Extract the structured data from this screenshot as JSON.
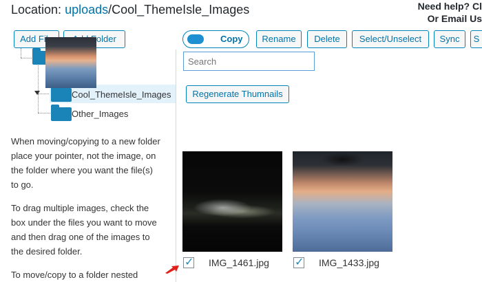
{
  "header": {
    "location_prefix": "Location: ",
    "location_link": "uploads",
    "location_rest": "/Cool_ThemeIsle_Images",
    "help_line1": "Need help? Cl",
    "help_line2": "Or Email Us"
  },
  "left": {
    "add_file_label": "Add File",
    "add_folder_label": "Add Folder",
    "tree": [
      {
        "label": "Cool_ThemeIsle_Images",
        "selected": true
      },
      {
        "label": "Other_Images",
        "selected": false
      }
    ],
    "help_paragraphs": [
      "When moving/copying to a new folder place your pointer, not the image, on the folder where you want the file(s) to go.",
      "To drag multiple images, check the box under the files you want to move and then drag one of the images to the desired folder.",
      "To move/copy to a folder nested"
    ]
  },
  "toolbar": {
    "copy_label": "Copy",
    "rename_label": "Rename",
    "delete_label": "Delete",
    "select_label": "Select/Unselect",
    "sync_label": "Sync",
    "cut_label": "S",
    "search_placeholder": "Search",
    "regenerate_label": "Regenerate Thumnails"
  },
  "files": [
    {
      "name": "IMG_1461.jpg",
      "checked": true
    },
    {
      "name": "IMG_1433.jpg",
      "checked": true
    }
  ],
  "colors": {
    "accent": "#0073aa",
    "folder": "#1a83b8",
    "pointer": "#e0211b"
  }
}
